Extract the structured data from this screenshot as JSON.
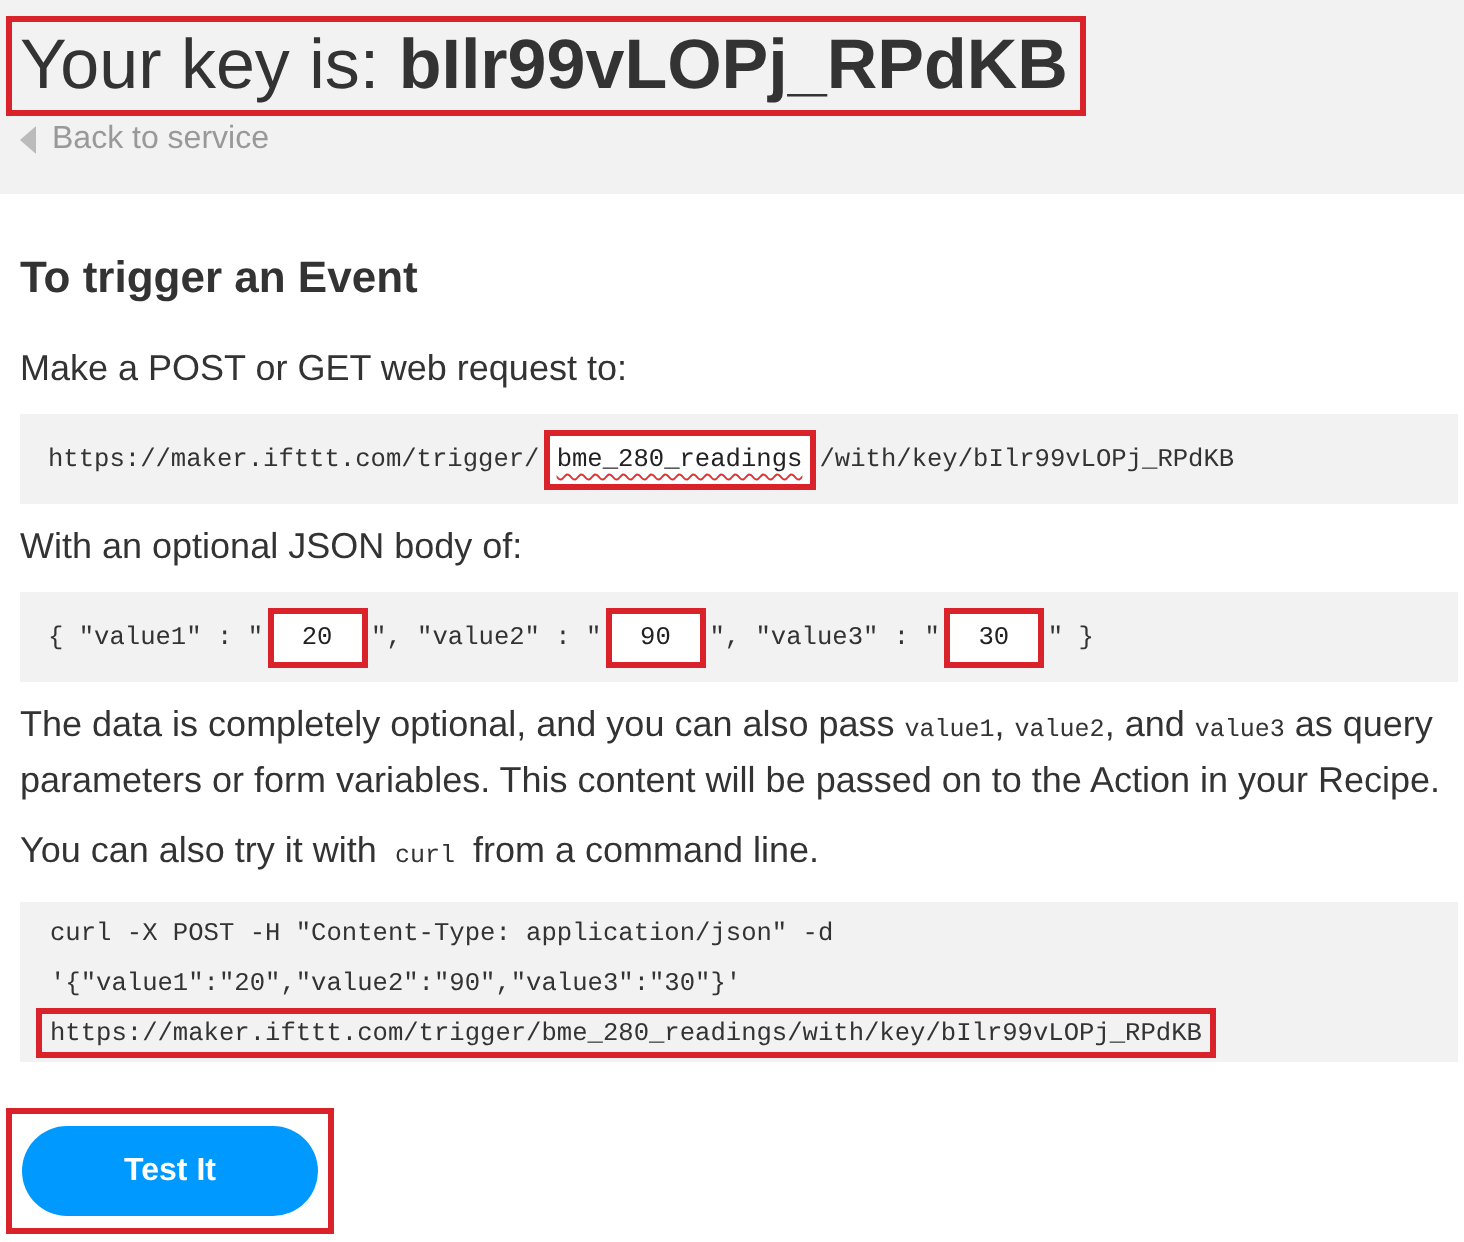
{
  "header": {
    "title": "Your key is: **bIlr99vLOPj_RPdKB**",
    "highlighted": true,
    "back_link": "Back to service"
  },
  "section": {
    "heading": "To trigger an Event",
    "request_intro": "Make a POST or GET web request to:",
    "request_url": [
      {
        "kind": "code",
        "text": "https://maker.ifttt.com/trigger/"
      },
      {
        "kind": "field",
        "value": "bme_280_readings",
        "highlighted": true,
        "spell_error": true
      },
      {
        "kind": "code",
        "text": "/with/key/bIlr99vLOPj_RPdKB"
      }
    ],
    "body_intro": "With an optional JSON body of:",
    "json_body": [
      {
        "kind": "code",
        "text": "{ \"value1\" : \""
      },
      {
        "kind": "field",
        "value": "20",
        "highlighted": true,
        "spell_error": false
      },
      {
        "kind": "code",
        "text": "\", \"value2\" : \""
      },
      {
        "kind": "field",
        "value": "90",
        "highlighted": true,
        "spell_error": false
      },
      {
        "kind": "code",
        "text": "\", \"value3\" : \""
      },
      {
        "kind": "field",
        "value": "30",
        "highlighted": true,
        "spell_error": false
      },
      {
        "kind": "code",
        "text": "\" }"
      }
    ],
    "note": [
      {
        "kind": "text",
        "text": "The data is completely optional, and you can also pass "
      },
      {
        "kind": "code",
        "text": "value1"
      },
      {
        "kind": "text",
        "text": ", "
      },
      {
        "kind": "code",
        "text": "value2"
      },
      {
        "kind": "text",
        "text": ", and "
      },
      {
        "kind": "code",
        "text": "value3"
      },
      {
        "kind": "text",
        "text": " as query parameters or form variables. This content will be passed on to the Action in your Recipe."
      }
    ],
    "curl_intro": [
      {
        "kind": "text",
        "text": "You can also try it with "
      },
      {
        "kind": "code",
        "text": "curl"
      },
      {
        "kind": "text",
        "text": " from a command line."
      }
    ],
    "curl_lines": [
      {
        "text": "curl -X POST -H \"Content-Type: application/json\" -d",
        "highlighted": false
      },
      {
        "text": "'{\"value1\":\"20\",\"value2\":\"90\",\"value3\":\"30\"}'",
        "highlighted": false
      },
      {
        "text": "https://maker.ifttt.com/trigger/bme_280_readings/with/key/bIlr99vLOPj_RPdKB",
        "highlighted": true
      }
    ],
    "test_button": {
      "label": "Test It",
      "highlighted": true
    }
  }
}
